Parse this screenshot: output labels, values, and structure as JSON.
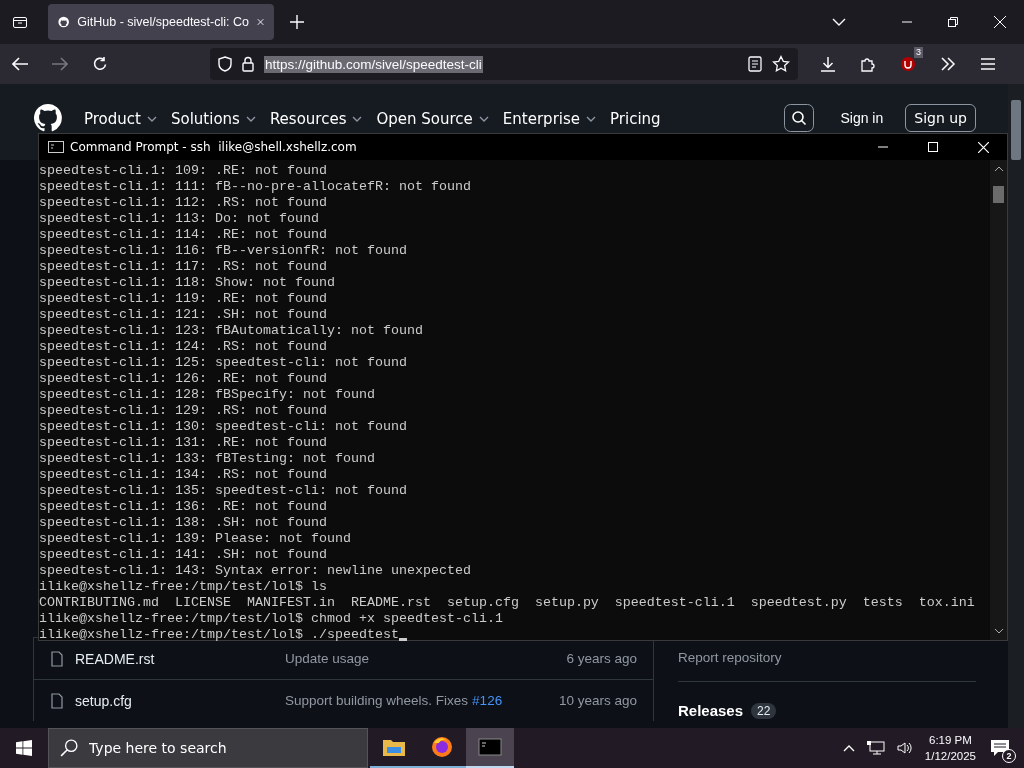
{
  "browser": {
    "tab": {
      "title": "GitHub - sivel/speedtest-cli: Co",
      "selected": true
    },
    "url": "https://github.com/sivel/speedtest-cli",
    "extension_badge": "3"
  },
  "github": {
    "nav": [
      {
        "label": "Product",
        "has_menu": true
      },
      {
        "label": "Solutions",
        "has_menu": true
      },
      {
        "label": "Resources",
        "has_menu": true
      },
      {
        "label": "Open Source",
        "has_menu": true
      },
      {
        "label": "Enterprise",
        "has_menu": true
      },
      {
        "label": "Pricing",
        "has_menu": false
      }
    ],
    "sign_in": "Sign in",
    "sign_up": "Sign up",
    "files": [
      {
        "name": "README.rst",
        "message": "Update usage",
        "age": "6 years ago"
      },
      {
        "name": "setup.cfg",
        "message": "Support building wheels. Fixes",
        "issue": "#126",
        "age": "10 years ago"
      }
    ],
    "sidebar": {
      "report": "Report repository",
      "releases": "Releases",
      "releases_count": "22"
    }
  },
  "terminal": {
    "title": "Command Prompt - ssh  ilike@shell.xshellz.com",
    "cursor": true,
    "lines": [
      "speedtest-cli.1: 109: .RE: not found",
      "speedtest-cli.1: 111: fB--no-pre-allocatefR: not found",
      "speedtest-cli.1: 112: .RS: not found",
      "speedtest-cli.1: 113: Do: not found",
      "speedtest-cli.1: 114: .RE: not found",
      "speedtest-cli.1: 116: fB--versionfR: not found",
      "speedtest-cli.1: 117: .RS: not found",
      "speedtest-cli.1: 118: Show: not found",
      "speedtest-cli.1: 119: .RE: not found",
      "speedtest-cli.1: 121: .SH: not found",
      "speedtest-cli.1: 123: fBAutomatically: not found",
      "speedtest-cli.1: 124: .RS: not found",
      "speedtest-cli.1: 125: speedtest-cli: not found",
      "speedtest-cli.1: 126: .RE: not found",
      "speedtest-cli.1: 128: fBSpecify: not found",
      "speedtest-cli.1: 129: .RS: not found",
      "speedtest-cli.1: 130: speedtest-cli: not found",
      "speedtest-cli.1: 131: .RE: not found",
      "speedtest-cli.1: 133: fBTesting: not found",
      "speedtest-cli.1: 134: .RS: not found",
      "speedtest-cli.1: 135: speedtest-cli: not found",
      "speedtest-cli.1: 136: .RE: not found",
      "speedtest-cli.1: 138: .SH: not found",
      "speedtest-cli.1: 139: Please: not found",
      "speedtest-cli.1: 141: .SH: not found",
      "speedtest-cli.1: 143: Syntax error: newline unexpected",
      "ilike@xshellz-free:/tmp/test/lol$ ls",
      "CONTRIBUTING.md  LICENSE  MANIFEST.in  README.rst  setup.cfg  setup.py  speedtest-cli.1  speedtest.py  tests  tox.ini",
      "ilike@xshellz-free:/tmp/test/lol$ chmod +x speedtest-cli.1",
      "ilike@xshellz-free:/tmp/test/lol$ ./speedtest"
    ]
  },
  "taskbar": {
    "search_placeholder": "Type here to search",
    "apps": [
      {
        "kind": "folder",
        "selected": false
      },
      {
        "kind": "firefox",
        "selected": false
      },
      {
        "kind": "console",
        "selected": true
      }
    ],
    "time": "6:19 PM",
    "date": "1/12/2025",
    "notifications": "2"
  }
}
